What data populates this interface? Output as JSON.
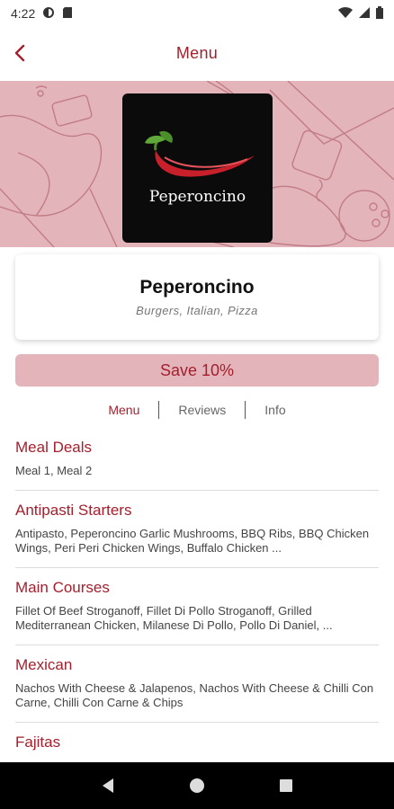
{
  "status_bar": {
    "time": "4:22"
  },
  "header": {
    "title": "Menu"
  },
  "restaurant": {
    "logo_text": "Peperoncino",
    "name": "Peperoncino",
    "cuisine": "Burgers, Italian, Pizza"
  },
  "promo": {
    "label": "Save 10%"
  },
  "tabs": [
    {
      "label": "Menu"
    },
    {
      "label": "Reviews"
    },
    {
      "label": "Info"
    }
  ],
  "categories": [
    {
      "title": "Meal Deals",
      "items": "Meal 1, Meal 2"
    },
    {
      "title": "Antipasti Starters",
      "items": "Antipasto, Peperoncino Garlic Mushrooms, BBQ Ribs, BBQ Chicken Wings, Peri Peri Chicken Wings, Buffalo Chicken ..."
    },
    {
      "title": "Main Courses",
      "items": "Fillet Of Beef Stroganoff, Fillet Di Pollo Stroganoff, Grilled Mediterranean Chicken, Milanese Di Pollo, Pollo Di Daniel, ..."
    },
    {
      "title": "Mexican",
      "items": "Nachos With Cheese & Jalapenos, Nachos With Cheese & Chilli Con Carne, Chilli Con Carne & Chips"
    },
    {
      "title": "Fajitas",
      "items": ""
    }
  ],
  "colors": {
    "accent": "#a41f2d",
    "hero_bg": "#e3b5bb"
  }
}
